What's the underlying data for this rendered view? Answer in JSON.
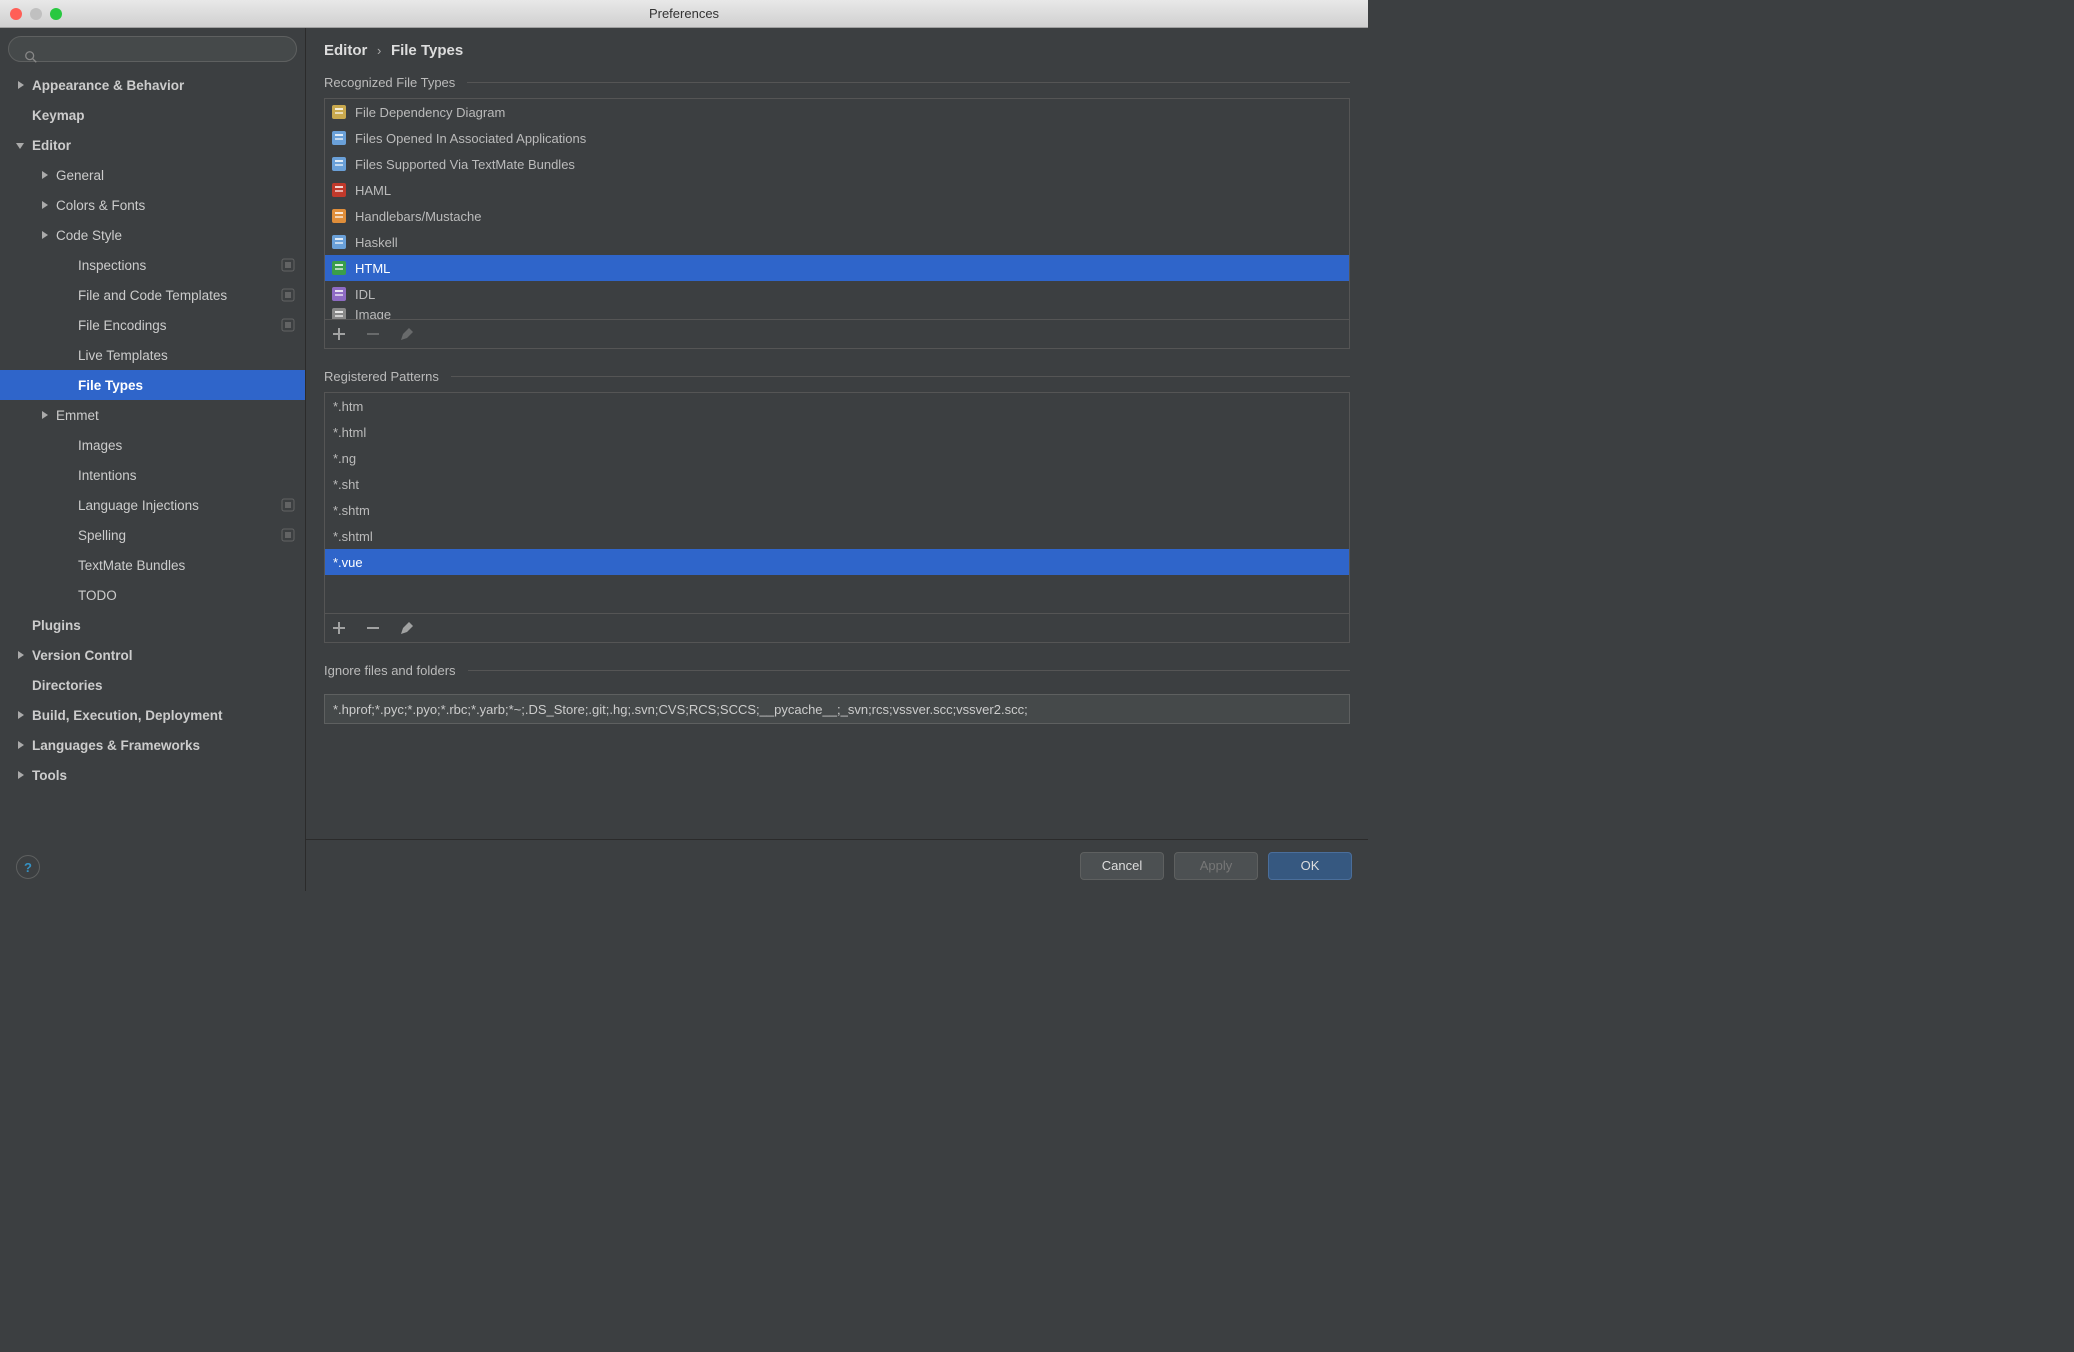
{
  "window": {
    "title": "Preferences"
  },
  "sidebar": {
    "search_placeholder": "",
    "items": [
      {
        "label": "Appearance & Behavior",
        "bold": true,
        "level": 0,
        "arrow": "right"
      },
      {
        "label": "Keymap",
        "bold": true,
        "level": 0,
        "arrow": "none"
      },
      {
        "label": "Editor",
        "bold": true,
        "level": 0,
        "arrow": "down"
      },
      {
        "label": "General",
        "level": 1,
        "arrow": "right"
      },
      {
        "label": "Colors & Fonts",
        "level": 1,
        "arrow": "right"
      },
      {
        "label": "Code Style",
        "level": 1,
        "arrow": "right"
      },
      {
        "label": "Inspections",
        "level": 2,
        "arrow": "none",
        "badge": true
      },
      {
        "label": "File and Code Templates",
        "level": 2,
        "arrow": "none",
        "badge": true
      },
      {
        "label": "File Encodings",
        "level": 2,
        "arrow": "none",
        "badge": true
      },
      {
        "label": "Live Templates",
        "level": 2,
        "arrow": "none"
      },
      {
        "label": "File Types",
        "level": 2,
        "arrow": "none",
        "selected": true
      },
      {
        "label": "Emmet",
        "level": 1,
        "arrow": "right"
      },
      {
        "label": "Images",
        "level": 2,
        "arrow": "none"
      },
      {
        "label": "Intentions",
        "level": 2,
        "arrow": "none"
      },
      {
        "label": "Language Injections",
        "level": 2,
        "arrow": "none",
        "badge": true
      },
      {
        "label": "Spelling",
        "level": 2,
        "arrow": "none",
        "badge": true
      },
      {
        "label": "TextMate Bundles",
        "level": 2,
        "arrow": "none"
      },
      {
        "label": "TODO",
        "level": 2,
        "arrow": "none"
      },
      {
        "label": "Plugins",
        "bold": true,
        "level": 0,
        "arrow": "none"
      },
      {
        "label": "Version Control",
        "bold": true,
        "level": 0,
        "arrow": "right"
      },
      {
        "label": "Directories",
        "bold": true,
        "level": 0,
        "arrow": "none"
      },
      {
        "label": "Build, Execution, Deployment",
        "bold": true,
        "level": 0,
        "arrow": "right"
      },
      {
        "label": "Languages & Frameworks",
        "bold": true,
        "level": 0,
        "arrow": "right"
      },
      {
        "label": "Tools",
        "bold": true,
        "level": 0,
        "arrow": "right"
      }
    ]
  },
  "breadcrumb": {
    "parent": "Editor",
    "current": "File Types"
  },
  "sections": {
    "recognized": "Recognized File Types",
    "patterns": "Registered Patterns",
    "ignore": "Ignore files and folders"
  },
  "filetypes": [
    {
      "label": "File Dependency Diagram",
      "icon": "diagram"
    },
    {
      "label": "Files Opened In Associated Applications",
      "icon": "doc"
    },
    {
      "label": "Files Supported Via TextMate Bundles",
      "icon": "doc"
    },
    {
      "label": "HAML",
      "icon": "haml"
    },
    {
      "label": "Handlebars/Mustache",
      "icon": "hbs"
    },
    {
      "label": "Haskell",
      "icon": "doc"
    },
    {
      "label": "HTML",
      "icon": "html",
      "selected": true
    },
    {
      "label": "IDL",
      "icon": "idl"
    },
    {
      "label": "Image",
      "icon": "img",
      "partial": true
    }
  ],
  "patterns": [
    {
      "label": "*.htm"
    },
    {
      "label": "*.html"
    },
    {
      "label": "*.ng"
    },
    {
      "label": "*.sht"
    },
    {
      "label": "*.shtm"
    },
    {
      "label": "*.shtml"
    },
    {
      "label": "*.vue",
      "selected": true
    }
  ],
  "ignore_value": "*.hprof;*.pyc;*.pyo;*.rbc;*.yarb;*~;.DS_Store;.git;.hg;.svn;CVS;RCS;SCCS;__pycache__;_svn;rcs;vssver.scc;vssver2.scc;",
  "buttons": {
    "cancel": "Cancel",
    "apply": "Apply",
    "ok": "OK"
  }
}
